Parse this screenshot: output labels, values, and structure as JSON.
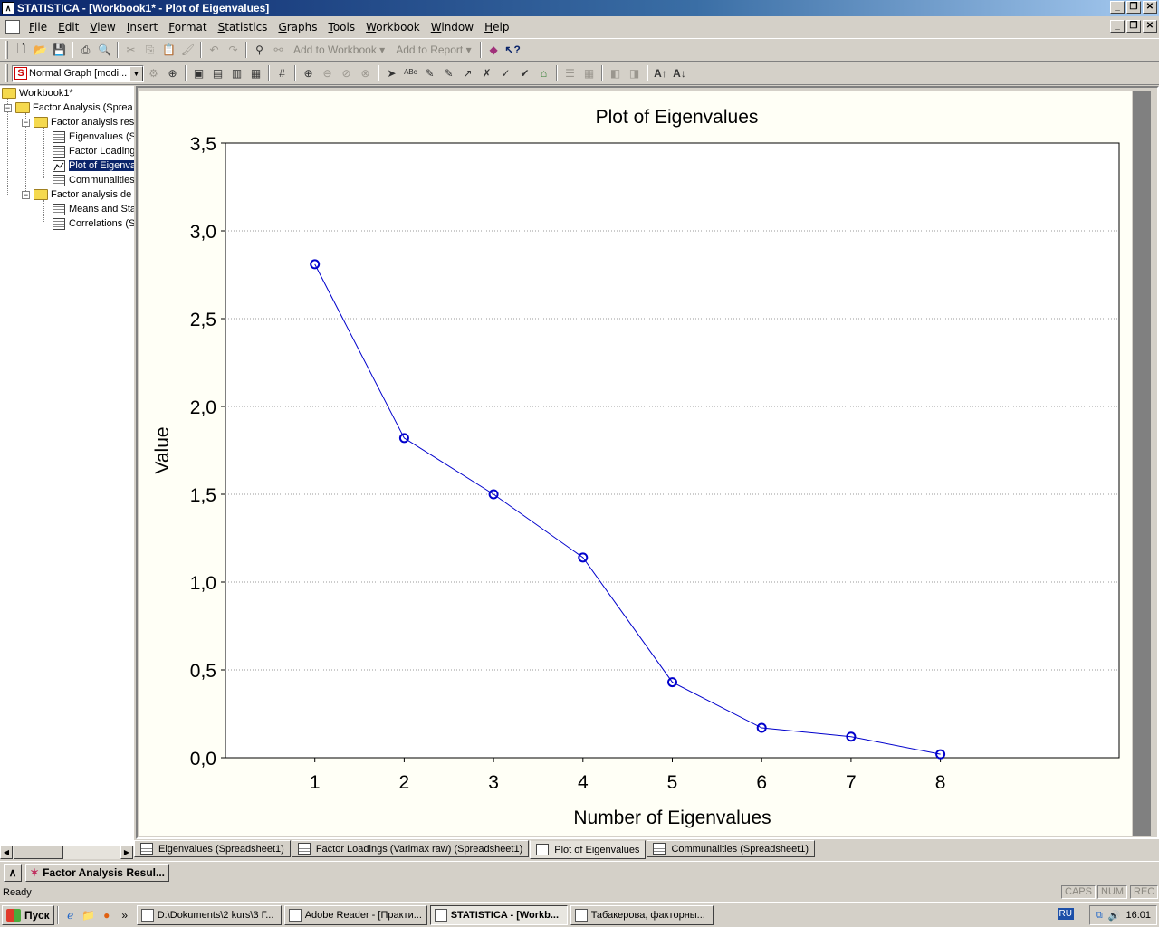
{
  "window": {
    "title": "STATISTICA - [Workbook1* - Plot of Eigenvalues]"
  },
  "menubar": {
    "items": [
      "File",
      "Edit",
      "View",
      "Insert",
      "Format",
      "Statistics",
      "Graphs",
      "Tools",
      "Workbook",
      "Window",
      "Help"
    ]
  },
  "toolbar": {
    "add_to_workbook": "Add to Workbook",
    "add_to_report": "Add to Report",
    "graph_type": "Normal Graph [modi..."
  },
  "tree": {
    "items": [
      {
        "label": "Workbook1*",
        "kind": "folder"
      },
      {
        "label": "Factor Analysis (Sprea",
        "kind": "folder"
      },
      {
        "label": "Factor analysis res",
        "kind": "folder"
      },
      {
        "label": "Eigenvalues (S",
        "kind": "sheet"
      },
      {
        "label": "Factor Loading",
        "kind": "sheet"
      },
      {
        "label": "Plot of Eigenva",
        "kind": "graph",
        "selected": true
      },
      {
        "label": "Communalities",
        "kind": "sheet"
      },
      {
        "label": "Factor analysis de",
        "kind": "folder"
      },
      {
        "label": "Means and Sta",
        "kind": "sheet"
      },
      {
        "label": "Correlations (S",
        "kind": "sheet"
      }
    ]
  },
  "chart_data": {
    "type": "line",
    "title": "Plot of Eigenvalues",
    "xlabel": "Number of Eigenvalues",
    "ylabel": "Value",
    "x": [
      1,
      2,
      3,
      4,
      5,
      6,
      7,
      8
    ],
    "values": [
      2.81,
      1.82,
      1.5,
      1.14,
      0.43,
      0.17,
      0.12,
      0.02
    ],
    "xlim": [
      0,
      10
    ],
    "ylim": [
      0,
      3.5
    ],
    "x_ticks": [
      "1",
      "2",
      "3",
      "4",
      "5",
      "6",
      "7",
      "8"
    ],
    "y_ticks": [
      "0,0",
      "0,5",
      "1,0",
      "1,5",
      "2,0",
      "2,5",
      "3,0",
      "3,5"
    ],
    "grid": "horizontal dotted",
    "line_color": "#0000cc"
  },
  "tabs": [
    {
      "label": "Eigenvalues (Spreadsheet1)",
      "kind": "sheet"
    },
    {
      "label": "Factor Loadings (Varimax raw) (Spreadsheet1)",
      "kind": "sheet"
    },
    {
      "label": "Plot of Eigenvalues",
      "kind": "graph",
      "active": true
    },
    {
      "label": "Communalities (Spreadsheet1)",
      "kind": "sheet"
    }
  ],
  "docbar": {
    "button": "Factor Analysis Resul..."
  },
  "status": {
    "text": "Ready",
    "caps": "CAPS",
    "num": "NUM",
    "rec": "REC"
  },
  "taskbar": {
    "start": "Пуск",
    "tasks": [
      {
        "label": "D:\\Dokuments\\2 kurs\\3 Г...",
        "active": false
      },
      {
        "label": "Adobe Reader - [Практи...",
        "active": false
      },
      {
        "label": "STATISTICA - [Workb...",
        "active": true
      },
      {
        "label": "Табакерова, факторны...",
        "active": false
      }
    ],
    "lang": "RU",
    "clock": "16:01"
  }
}
